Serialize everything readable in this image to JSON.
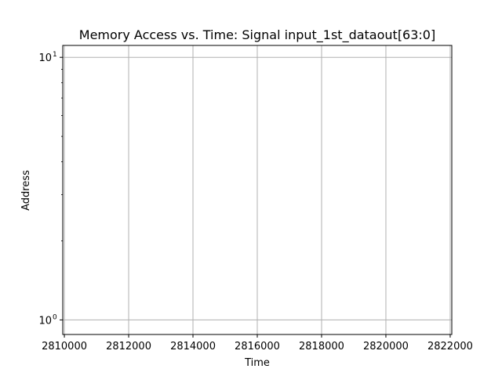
{
  "chart_data": {
    "type": "scatter",
    "title": "Memory Access vs. Time: Signal input_1st_dataout[63:0]",
    "xlabel": "Time",
    "ylabel": "Address",
    "xlim": [
      2809950,
      2822050
    ],
    "x_ticks": [
      2810000,
      2812000,
      2814000,
      2816000,
      2818000,
      2820000,
      2822000
    ],
    "x_tick_labels": [
      "2810000",
      "2812000",
      "2814000",
      "2816000",
      "2818000",
      "2820000",
      "2822000"
    ],
    "ylim": [
      0.88,
      11.1
    ],
    "yscale": "log",
    "y_ticks": [
      1,
      10
    ],
    "y_tick_labels": [
      "10",
      "10"
    ],
    "y_tick_exponents": [
      "0",
      "1"
    ],
    "grid": true,
    "series": [
      {
        "x": [],
        "y": []
      }
    ],
    "colors": {
      "grid": "#b0b0b0",
      "axes": "#000000",
      "background": "#ffffff"
    }
  }
}
